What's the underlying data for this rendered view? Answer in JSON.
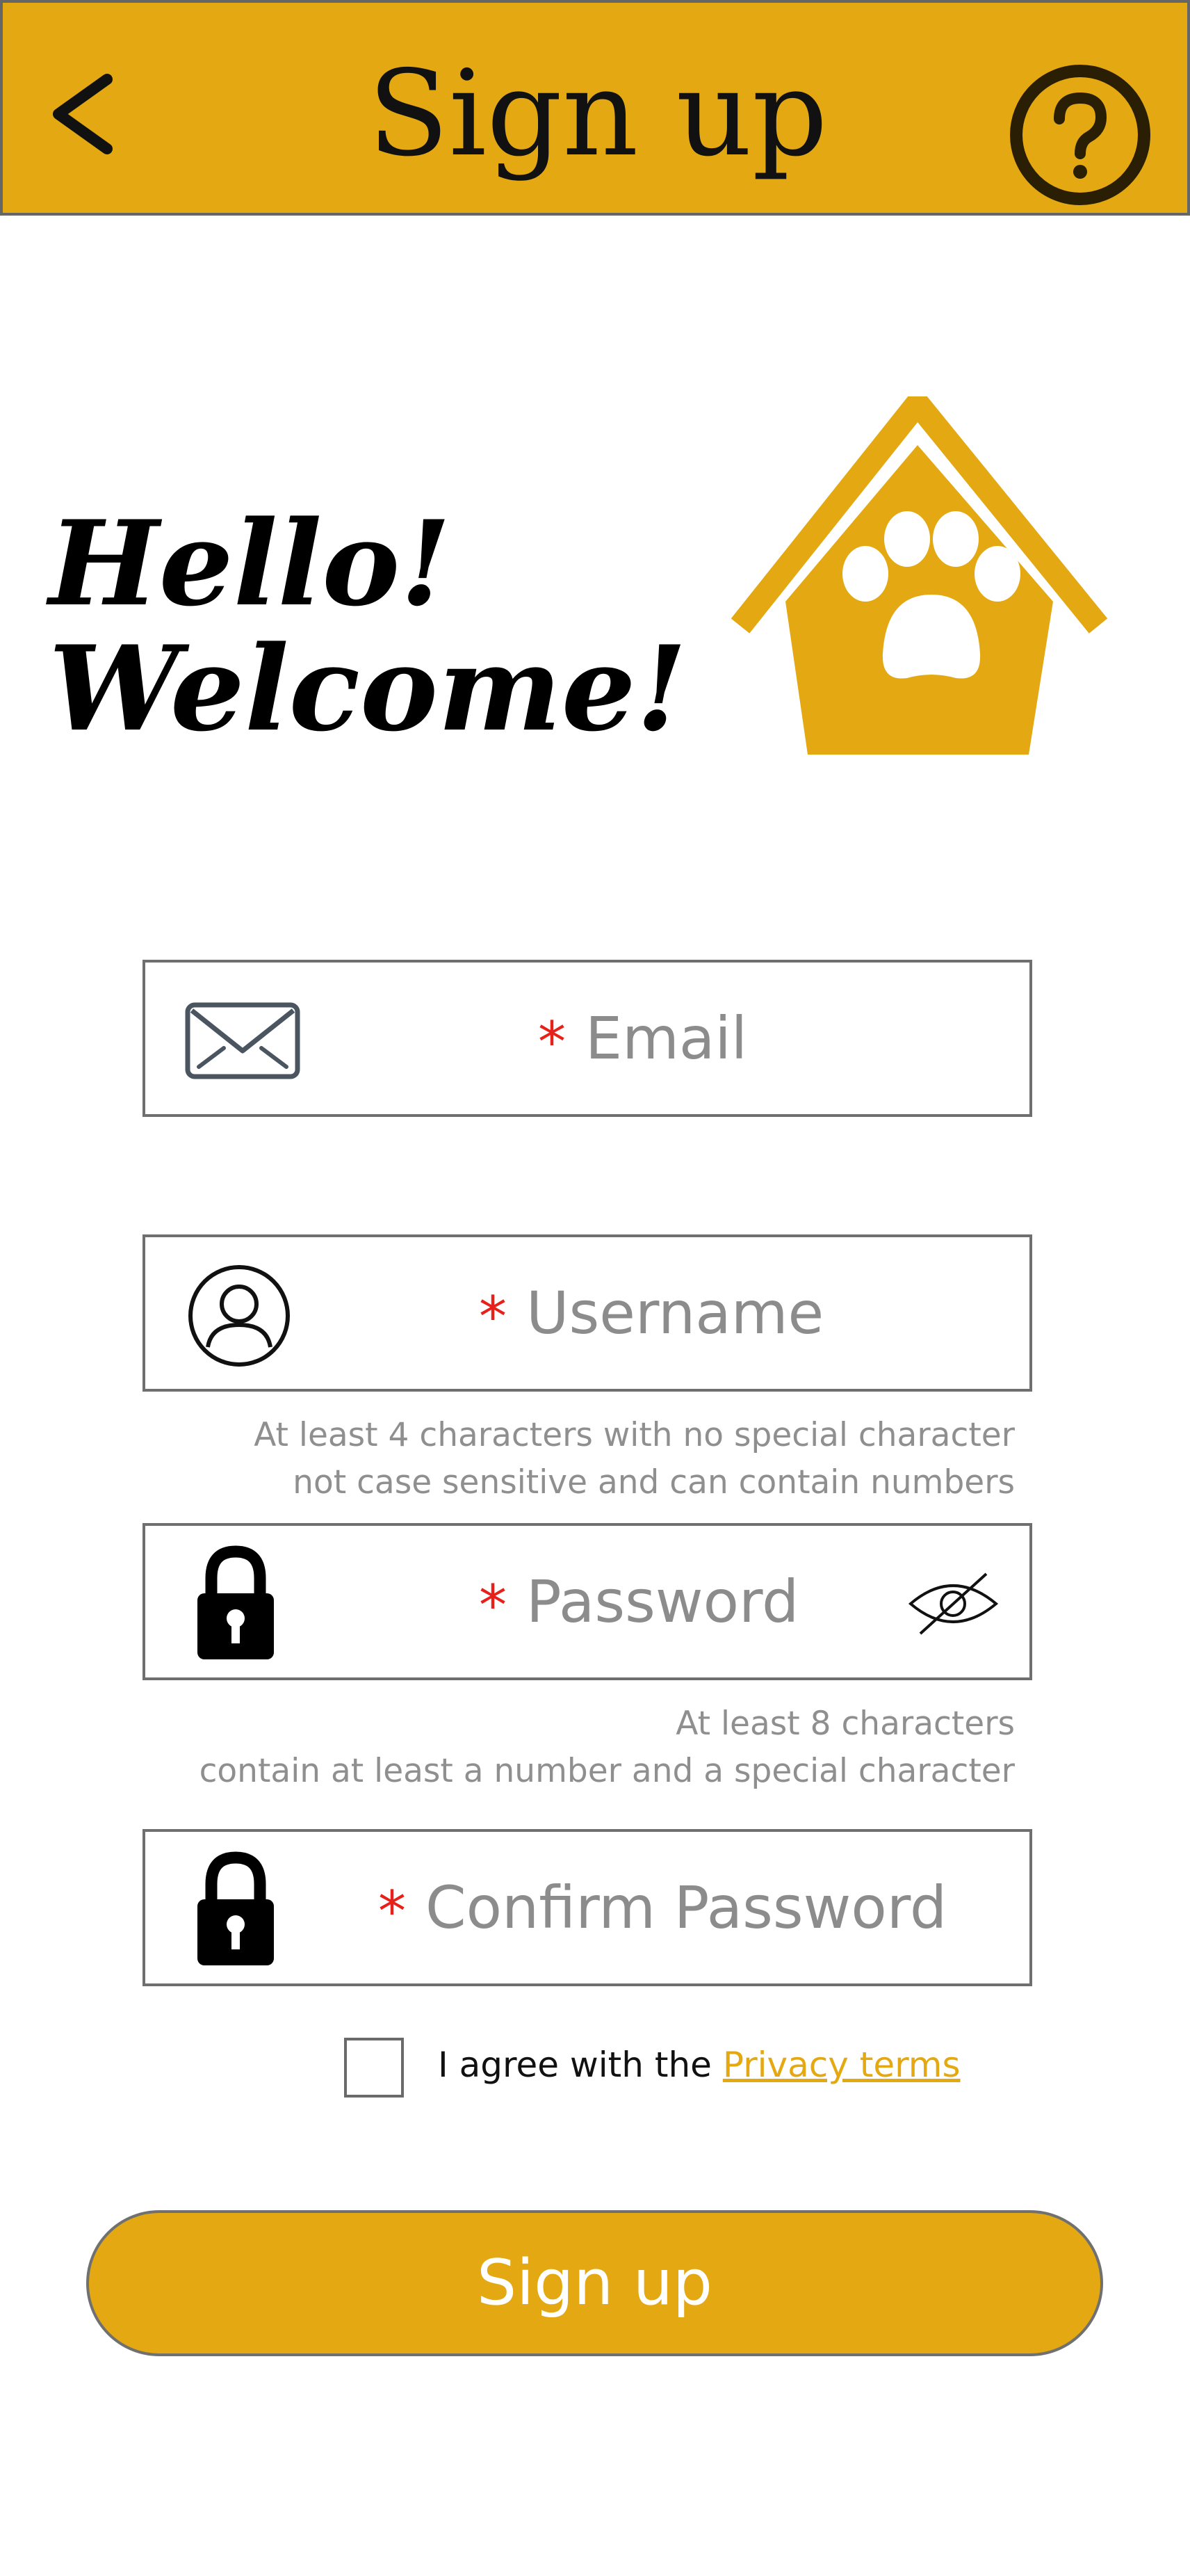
{
  "header": {
    "title": "Sign up",
    "back_icon": "chevron-left-icon",
    "help_icon": "question-mark-icon"
  },
  "colors": {
    "accent": "#E4A912",
    "required": "#E8201A",
    "placeholder": "#8C8C8C"
  },
  "greeting": {
    "line1": "Hello!",
    "line2": "Welcome!",
    "logo_icon": "paw-house-icon"
  },
  "form": {
    "required_mark": "*",
    "email": {
      "placeholder": "Email",
      "icon": "envelope-icon"
    },
    "username": {
      "placeholder": "Username",
      "icon": "user-circle-icon",
      "hint": [
        "At least 4 characters with no special character",
        "not case sensitive and can contain numbers"
      ]
    },
    "password": {
      "placeholder": "Password",
      "icon": "lock-icon",
      "toggle_icon": "eye-slash-icon",
      "hint": [
        "At least 8 characters",
        "contain at least a number and a special character"
      ]
    },
    "confirm_password": {
      "placeholder": "Confirm Password",
      "icon": "lock-icon"
    }
  },
  "agreement": {
    "text": "I agree with the ",
    "link": "Privacy terms",
    "checked": false
  },
  "submit": {
    "label": "Sign up"
  }
}
